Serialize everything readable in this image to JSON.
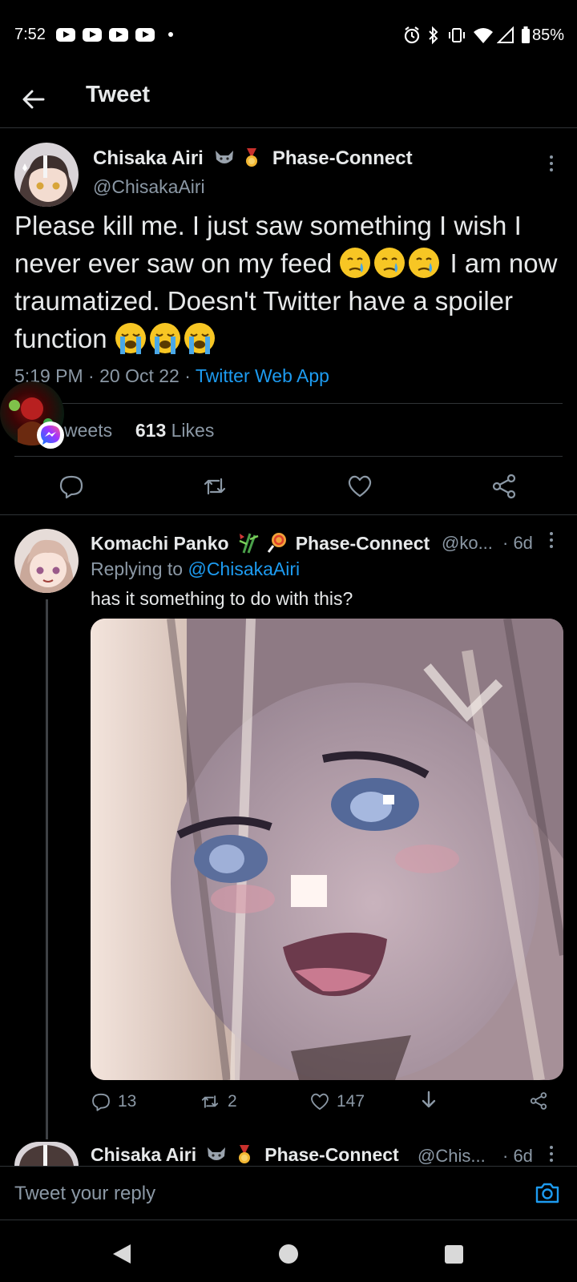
{
  "status_bar": {
    "time": "7:52",
    "battery": "85%"
  },
  "header": {
    "title": "Tweet"
  },
  "main_tweet": {
    "author_name": "Chisaka Airi",
    "author_tag": "Phase-Connect",
    "handle": "@ChisakaAiri",
    "text_parts": [
      "Please kill me. I just saw something I wish I never ever saw on my feed ",
      " I am now traumatized. Doesn't Twitter have a spoiler function "
    ],
    "time": "5:19 PM",
    "date": "20 Oct 22",
    "source": "Twitter Web App",
    "retweets_label": "weets",
    "likes_count": "613",
    "likes_label": "Likes"
  },
  "reply": {
    "author_name": "Komachi Panko",
    "author_tag": "Phase-Connect",
    "handle": "@ko...",
    "age": "· 6d",
    "replying_label": "Replying to",
    "replying_to": "@ChisakaAiri",
    "text": "has it something to do with this?",
    "replies": "13",
    "retweets": "2",
    "likes": "147"
  },
  "next_reply": {
    "author_name": "Chisaka Airi",
    "author_tag": "Phase-Connect",
    "handle": "@Chis...",
    "age": "· 6d"
  },
  "composer": {
    "placeholder": "Tweet your reply"
  },
  "colors": {
    "background": "#000000",
    "accent": "#1d9bf0",
    "secondary_text": "#8b98a5",
    "divider": "#2f3336"
  }
}
